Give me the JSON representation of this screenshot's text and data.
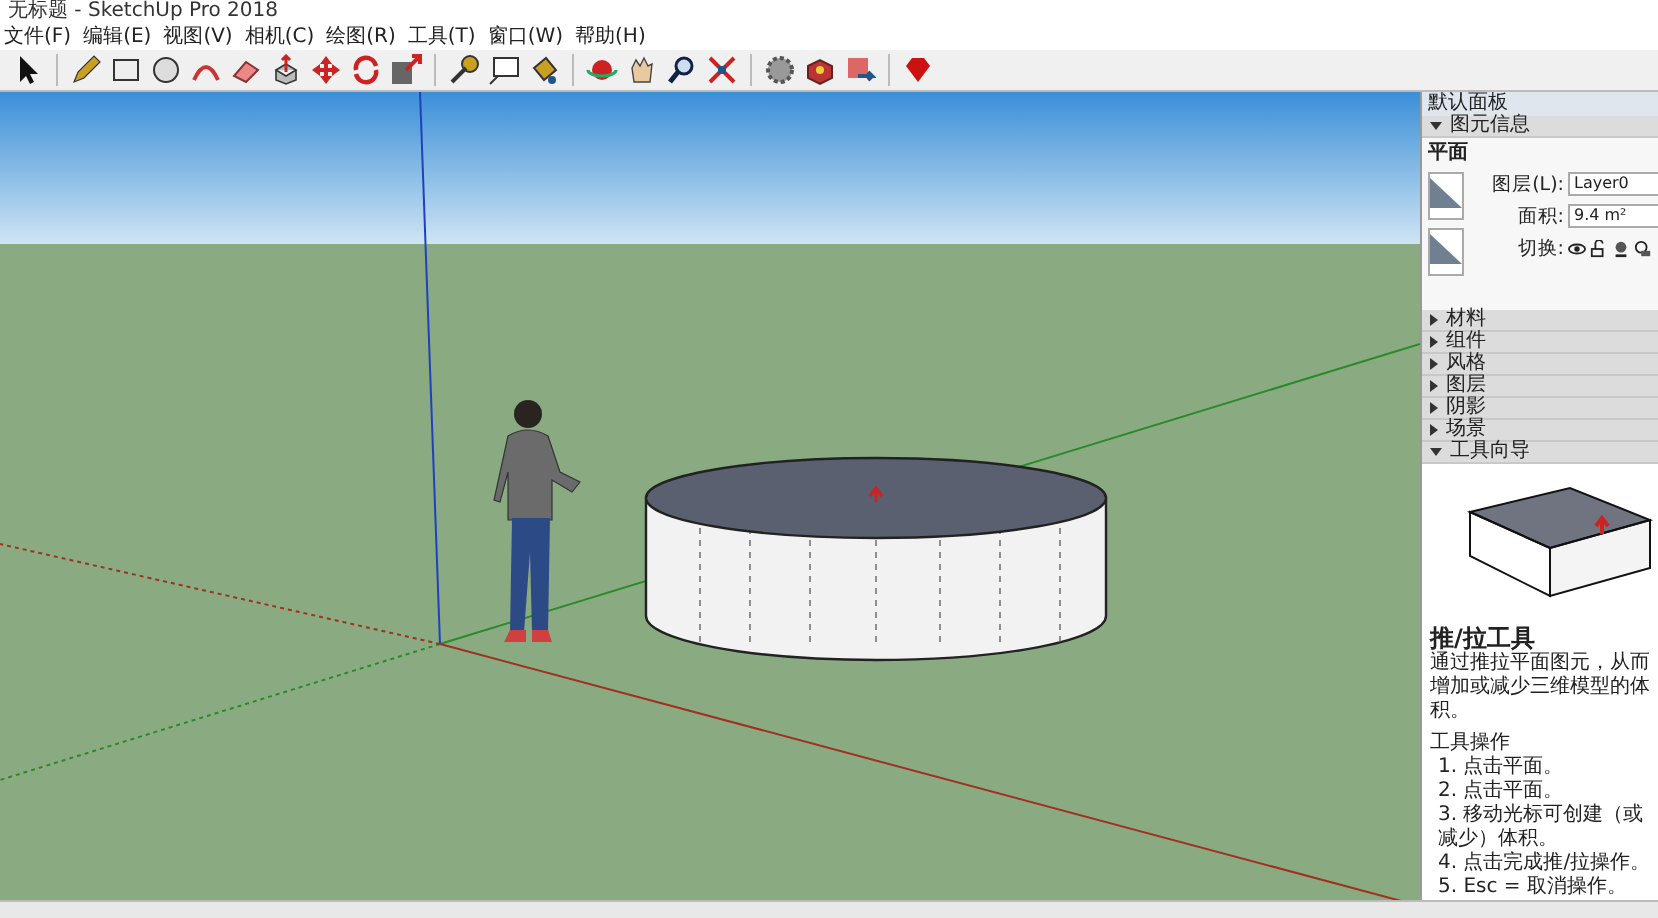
{
  "window": {
    "title": "无标题 - SketchUp Pro 2018"
  },
  "menu": [
    "文件(F)",
    "编辑(E)",
    "视图(V)",
    "相机(C)",
    "绘图(R)",
    "工具(T)",
    "窗口(W)",
    "帮助(H)"
  ],
  "tray": {
    "title": "默认面板",
    "entity_info": {
      "label": "图元信息",
      "expanded": true,
      "type": "平面",
      "layer_label": "图层(L):",
      "layer": "Layer0",
      "area_label": "面积:",
      "area": "9.4 m²",
      "toggle_label": "切换:"
    },
    "sections": [
      {
        "label": "材料",
        "expanded": false
      },
      {
        "label": "组件",
        "expanded": false
      },
      {
        "label": "风格",
        "expanded": false
      },
      {
        "label": "图层",
        "expanded": false
      },
      {
        "label": "阴影",
        "expanded": false
      },
      {
        "label": "场景",
        "expanded": false
      },
      {
        "label": "工具向导",
        "expanded": true
      }
    ],
    "instructor": {
      "title": "推/拉工具",
      "description": "通过推拉平面图元，从而增加或减少三维模型的体积。",
      "operations_title": "工具操作",
      "steps": [
        "1. 点击平面。",
        "2. 点击平面。",
        "3. 移动光标可创建（或减少）体积。",
        "4. 点击完成推/拉操作。",
        "5. Esc = 取消操作。"
      ]
    }
  }
}
